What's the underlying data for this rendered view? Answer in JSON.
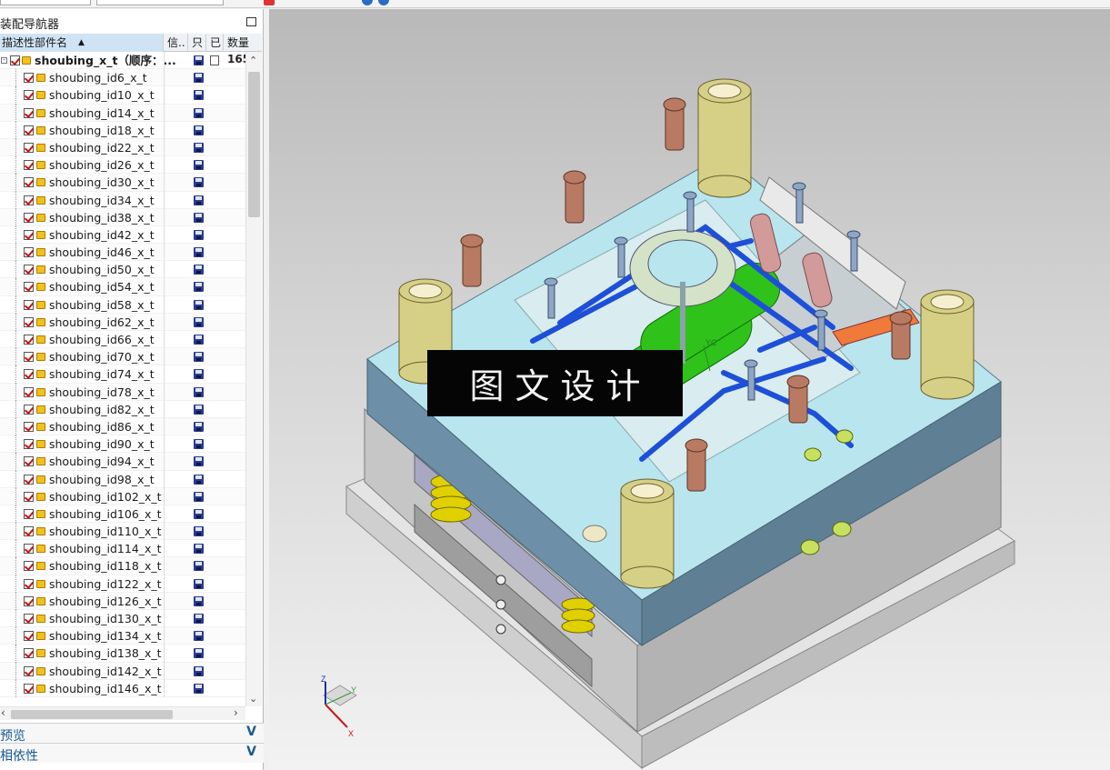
{
  "navigator": {
    "title": "装配导航器",
    "columns": [
      "描述性部件名",
      "信..",
      "只",
      "已",
      "数量"
    ],
    "sort_indicator": "▲",
    "root": {
      "name": "shoubing_x_t（顺序：...",
      "qty": "165"
    },
    "items": [
      "shoubing_id6_x_t",
      "shoubing_id10_x_t",
      "shoubing_id14_x_t",
      "shoubing_id18_x_t",
      "shoubing_id22_x_t",
      "shoubing_id26_x_t",
      "shoubing_id30_x_t",
      "shoubing_id34_x_t",
      "shoubing_id38_x_t",
      "shoubing_id42_x_t",
      "shoubing_id46_x_t",
      "shoubing_id50_x_t",
      "shoubing_id54_x_t",
      "shoubing_id58_x_t",
      "shoubing_id62_x_t",
      "shoubing_id66_x_t",
      "shoubing_id70_x_t",
      "shoubing_id74_x_t",
      "shoubing_id78_x_t",
      "shoubing_id82_x_t",
      "shoubing_id86_x_t",
      "shoubing_id90_x_t",
      "shoubing_id94_x_t",
      "shoubing_id98_x_t",
      "shoubing_id102_x_t",
      "shoubing_id106_x_t",
      "shoubing_id110_x_t",
      "shoubing_id114_x_t",
      "shoubing_id118_x_t",
      "shoubing_id122_x_t",
      "shoubing_id126_x_t",
      "shoubing_id130_x_t",
      "shoubing_id134_x_t",
      "shoubing_id138_x_t",
      "shoubing_id142_x_t",
      "shoubing_id146_x_t"
    ]
  },
  "panels": {
    "preview": "预览",
    "dependencies": "相依性"
  },
  "viewport": {
    "banner": "图文设计",
    "axis_labels": {
      "wcs": "YC",
      "z": "Z",
      "y": "Y",
      "x": "X"
    }
  },
  "colors": {
    "plate_top": "#b9e5ef",
    "plate_side": "#6d8fa8",
    "base_gray": "#c9c9c9",
    "core_green": "#2fc21a",
    "cooling_blue": "#1d4fd8",
    "bushing_olive": "#d6cf86",
    "screw_copper": "#b87a63"
  }
}
